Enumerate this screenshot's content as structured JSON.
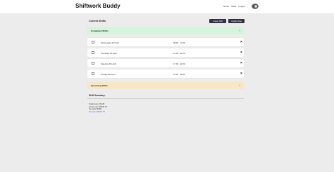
{
  "header": {
    "brand": "Shiftwork Buddy",
    "nav": [
      "Home",
      "Shifts",
      "Logout"
    ]
  },
  "main": {
    "title": "Current Shifts",
    "buttons": {
      "create": "Create Shift",
      "update": "Update Rate"
    },
    "completed_label": "Completed Shifts",
    "upcoming_label": "Upcoming Shifts",
    "shifts": [
      {
        "day": "Wednesday 3rd April",
        "time": "08:00 - 17:00"
      },
      {
        "day": "Thursday 4th April",
        "time": "12:00 - 22:00"
      },
      {
        "day": "Saturday 6th April",
        "time": "17:00 - 22:00"
      },
      {
        "day": "Sunday 9th April",
        "time": "12:00 - 18:00"
      }
    ]
  },
  "summary": {
    "title": "Shift Summary:",
    "lines": [
      "Total hours: 86.25",
      "Gross pay: $2543.75",
      "Tax paid: $469",
      "Net pay: $2044.75"
    ]
  },
  "colors": {
    "completed_bg": "#d6f4db",
    "upcoming_bg": "#f7e7c7",
    "button_bg": "#2f3142",
    "net_pay": "#3a6de0"
  }
}
